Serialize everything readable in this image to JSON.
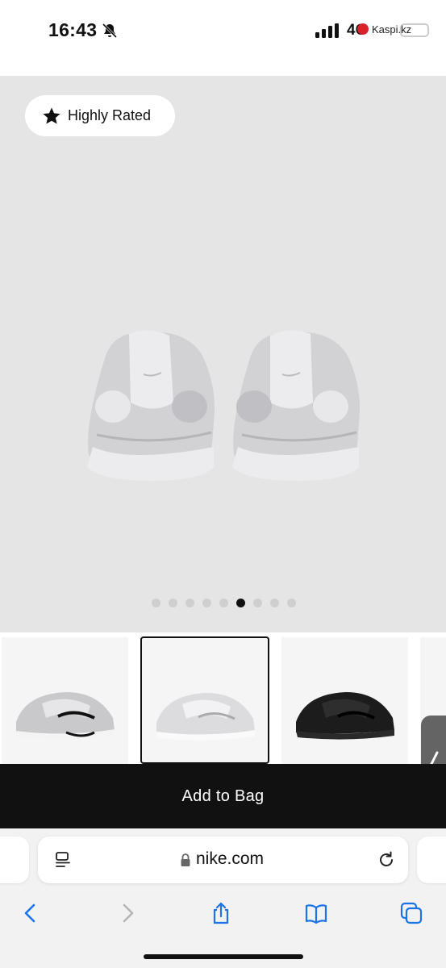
{
  "status_bar": {
    "time": "16:43",
    "network": "4G",
    "back_app": "Kaspi.kz"
  },
  "product": {
    "badge_label": "Highly Rated",
    "image_count": 9,
    "active_image_index": 5
  },
  "thumbnails": [
    {
      "label": "silver-black-colorway",
      "selected": false
    },
    {
      "label": "white-silver-colorway",
      "selected": true
    },
    {
      "label": "black-colorway",
      "selected": false
    },
    {
      "label": "more-colorway",
      "selected": false
    }
  ],
  "cta": {
    "add_to_bag_label": "Add to Bag"
  },
  "browser": {
    "url": "nike.com"
  },
  "colors": {
    "hero_bg": "#e5e5e5",
    "cta_bg": "#111111",
    "link_blue": "#1a73e8",
    "kaspi_red": "#d8232a"
  }
}
